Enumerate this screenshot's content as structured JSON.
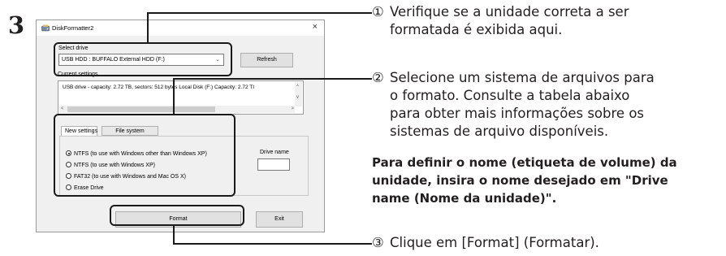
{
  "step_number": "3",
  "window": {
    "title": "DiskFormatter2",
    "close_glyph": "×",
    "select_drive_label": "Select drive",
    "selected_drive": "USB HDD : BUFFALO  External HDD     (F:)",
    "dropdown_chevron": "⌄",
    "refresh_label": "Refresh",
    "current_settings_label": "Current settings",
    "current_settings_text": "USB drive - capacity: 2.72 TB, sectors: 512 bytes   Local Disk (F:)    Capacity: 2.72 TI",
    "scroll_glyphs": {
      "left": "<",
      "right": ">",
      "up": "^",
      "down": "v"
    },
    "tabs": [
      "New settings",
      "File system"
    ],
    "file_system_options": [
      {
        "label": "NTFS (to use with Windows other than Windows XP)",
        "checked": true
      },
      {
        "label": "NTFS (to use with Windows XP)",
        "checked": false
      },
      {
        "label": "FAT32 (to use with Windows and Mac OS X)",
        "checked": false
      },
      {
        "label": "Erase Drive",
        "checked": false
      }
    ],
    "drive_name_label": "Drive name",
    "format_label": "Format",
    "exit_label": "Exit"
  },
  "annotations": [
    {
      "number": "①",
      "lines": [
        "Verifique se a unidade correta a ser",
        "formatada é exibida aqui."
      ]
    },
    {
      "number": "②",
      "lines": [
        "Selecione um sistema de arquivos para",
        "o formato. Consulte a tabela abaixo",
        "para obter mais informações sobre os",
        "sistemas de arquivo disponíveis."
      ]
    },
    {
      "number": "③",
      "lines": [
        "Clique em [Format] (Formatar)."
      ]
    }
  ],
  "note_lines": [
    "Para definir o nome (etiqueta de volume) da",
    "unidade, insira o nome desejado em \"Drive",
    "name (Nome da unidade)\"."
  ],
  "icons": {
    "app": "disk-formatter-app-icon",
    "close": "close-icon",
    "dropdown": "chevron-down-icon"
  }
}
